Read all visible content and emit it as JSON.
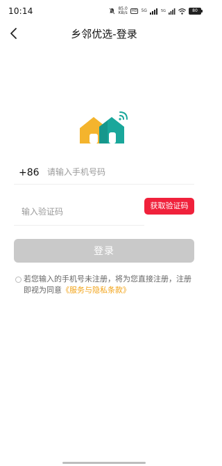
{
  "status_bar": {
    "time": "10:14",
    "speed": "85.0",
    "speed_unit": "KB/s",
    "network_a": "5G",
    "network_b": "5G",
    "battery": "80"
  },
  "header": {
    "title": "乡邻优选-登录",
    "back_icon": "chevron-left-icon"
  },
  "logo": {
    "icon": "house-wifi-logo",
    "colors": {
      "yellow": "#f4b42d",
      "teal": "#1aa79b"
    }
  },
  "form": {
    "country_code": "+86",
    "phone_placeholder": "请输入手机号码",
    "phone_value": "",
    "code_placeholder": "输入验证码",
    "code_value": "",
    "get_code_label": "获取验证码",
    "login_label": "登录"
  },
  "agreement": {
    "checked": false,
    "text_prefix": "若您输入的手机号未注册，将为您直接注册，注册即视为同意",
    "link_text": "《服务与隐私条款》"
  },
  "colors": {
    "accent_red": "#f0213b",
    "link_orange": "#f2a41a",
    "disabled_gray": "#c9c9c9"
  }
}
